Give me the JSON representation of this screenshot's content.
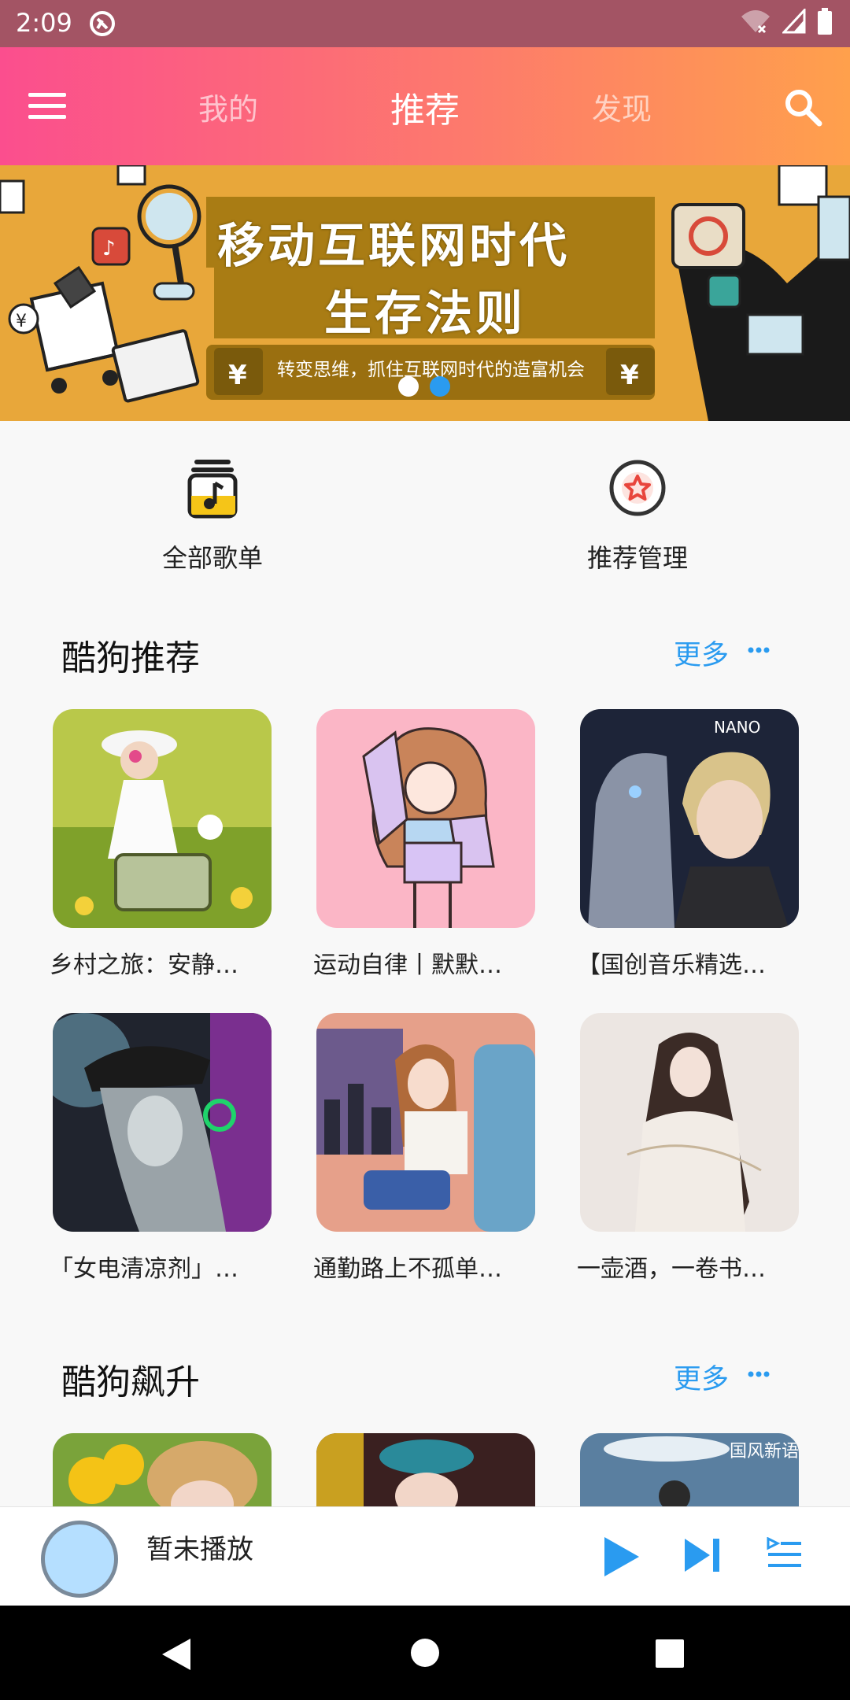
{
  "status_bar": {
    "time": "2:09"
  },
  "header": {
    "tabs": [
      {
        "label": "我的"
      },
      {
        "label": "推荐"
      },
      {
        "label": "发现"
      }
    ],
    "active_tab": "推荐"
  },
  "banner": {
    "title_line1": "移动互联网时代",
    "title_line2": "生存法则",
    "subtitle": "转变思维，抓住互联网时代的造富机会",
    "currency_symbol": "¥",
    "page_count": 2,
    "active_page": 2
  },
  "quick_entries": {
    "all_playlists": "全部歌单",
    "recommend_manage": "推荐管理"
  },
  "sections": {
    "recommend": {
      "title": "酷狗推荐",
      "more": "更多",
      "items": [
        {
          "title": "乡村之旅：安静惬..."
        },
        {
          "title": "运动自律丨默默努..."
        },
        {
          "title": "【国创音乐精选】..."
        },
        {
          "title": "「女电清凉剂」夏..."
        },
        {
          "title": "通勤路上不孤单！..."
        },
        {
          "title": "一壶酒，一卷书，..."
        }
      ]
    },
    "rising": {
      "title": "酷狗飙升",
      "more": "更多"
    }
  },
  "player": {
    "title": "暂未播放"
  },
  "colors": {
    "accent": "#2a9bf0",
    "header_start": "#fb4e8e",
    "header_end": "#ffa04c"
  }
}
